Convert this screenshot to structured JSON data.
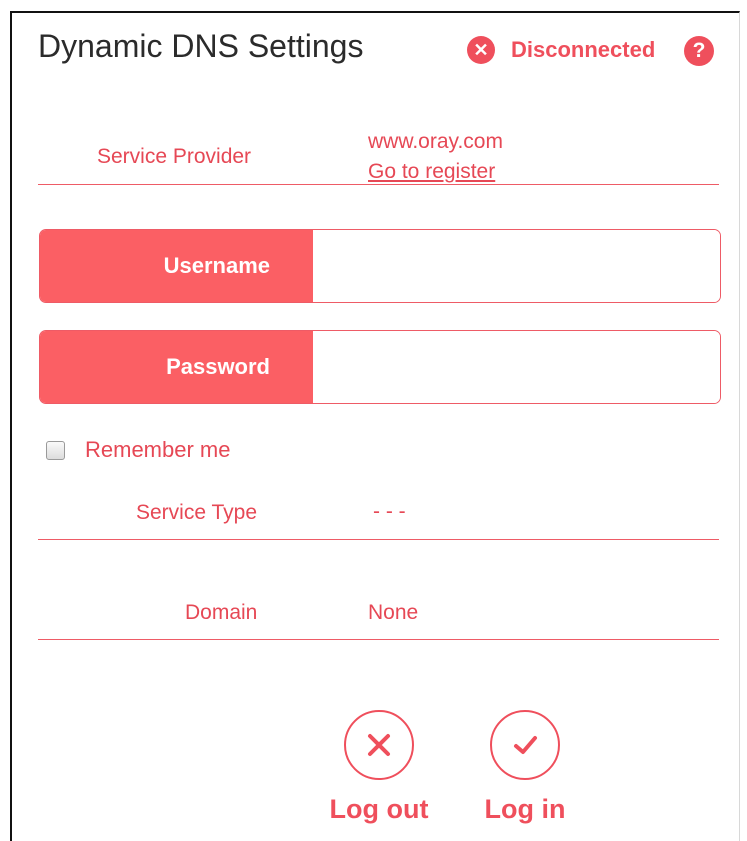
{
  "header": {
    "title": "Dynamic DNS Settings",
    "status_text": "Disconnected",
    "status_icon": "x-circle-icon",
    "help_icon": "question-circle-icon"
  },
  "service_provider": {
    "label": "Service Provider",
    "value": "www.oray.com",
    "register_link": "Go to register"
  },
  "username": {
    "label": "Username",
    "value": "",
    "placeholder": ""
  },
  "password": {
    "label": "Password",
    "value": "",
    "placeholder": ""
  },
  "remember_me": {
    "label": "Remember me",
    "checked": false
  },
  "service_type": {
    "label": "Service Type",
    "value": "- - -"
  },
  "domain": {
    "label": "Domain",
    "value": "None"
  },
  "actions": {
    "logout_label": "Log out",
    "login_label": "Log in"
  },
  "colors": {
    "accent": "#ef4f5c",
    "label_fill": "#fb5f64",
    "title_text": "#2b2b2b"
  }
}
